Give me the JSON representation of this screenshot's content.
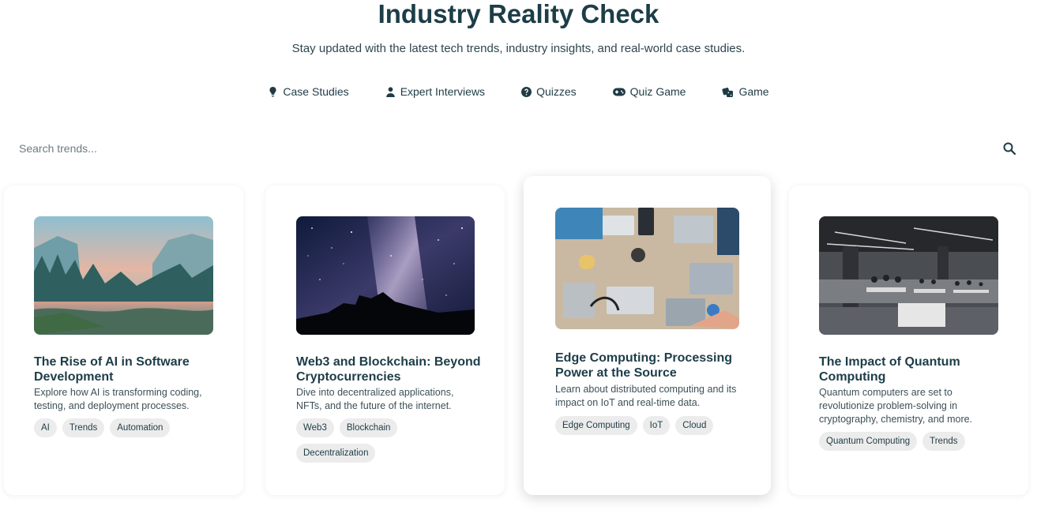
{
  "header": {
    "title": "Industry Reality Check",
    "subtitle": "Stay updated with the latest tech trends, industry insights, and real-world case studies."
  },
  "nav": [
    {
      "label": "Case Studies",
      "icon": "lightbulb-icon"
    },
    {
      "label": "Expert Interviews",
      "icon": "user-tie-icon"
    },
    {
      "label": "Quizzes",
      "icon": "question-circle-icon"
    },
    {
      "label": "Quiz Game",
      "icon": "gamepad-icon"
    },
    {
      "label": "Game",
      "icon": "dice-icon"
    }
  ],
  "search": {
    "placeholder": "Search trends...",
    "value": ""
  },
  "cards": [
    {
      "title": "The Rise of AI in Software Development",
      "desc": "Explore how AI is transforming coding, testing, and deployment processes.",
      "tags": [
        "AI",
        "Trends",
        "Automation"
      ],
      "image": "misty-mountain-lake-forest"
    },
    {
      "title": "Web3 and Blockchain: Beyond Cryptocurrencies",
      "desc": "Dive into decentralized applications, NFTs, and the future of the internet.",
      "tags": [
        "Web3",
        "Blockchain",
        "Decentralization"
      ],
      "image": "milky-way-night-sky"
    },
    {
      "title": "Edge Computing: Processing Power at the Source",
      "desc": "Learn about distributed computing and its impact on IoT and real-time data.",
      "tags": [
        "Edge Computing",
        "IoT",
        "Cloud"
      ],
      "image": "team-laptops-on-table"
    },
    {
      "title": "The Impact of Quantum Computing",
      "desc": "Quantum computers are set to revolutionize problem-solving in cryptography, chemistry, and more.",
      "tags": [
        "Quantum Computing",
        "Trends"
      ],
      "image": "open-office-workspace"
    }
  ],
  "colors": {
    "primary_text": "#1d3d48",
    "tag_bg": "#ececec"
  }
}
